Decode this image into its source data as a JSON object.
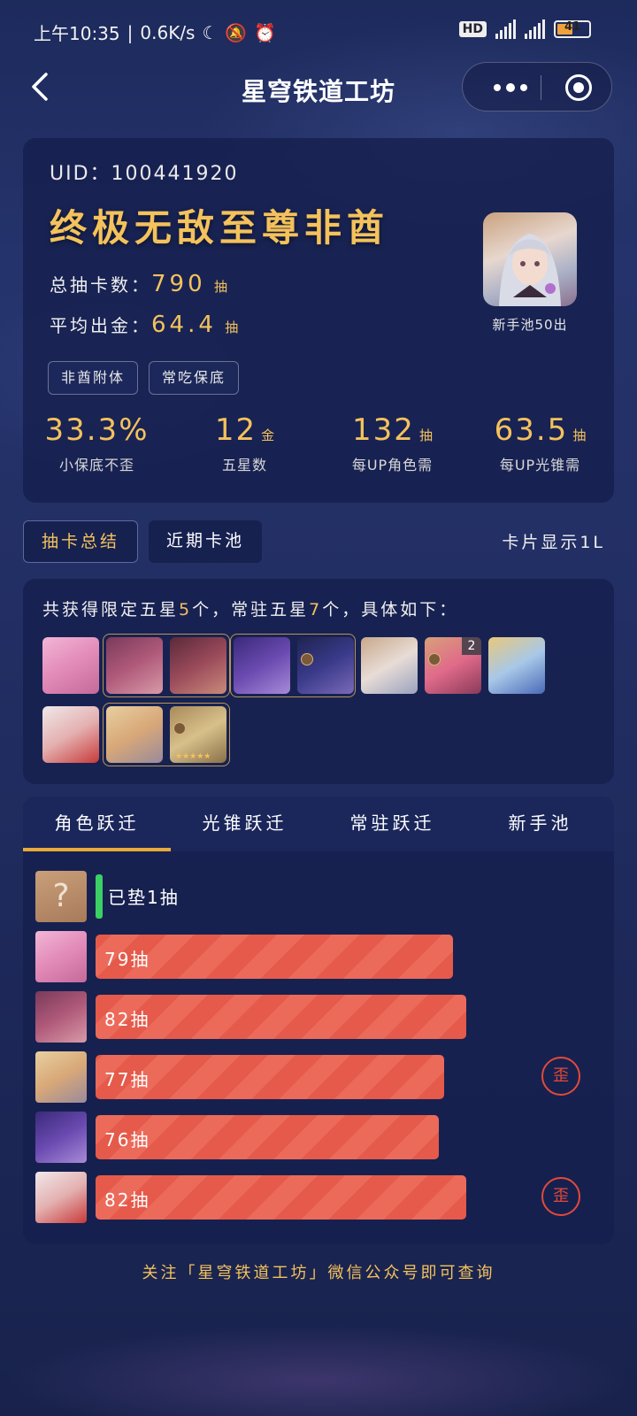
{
  "status_bar": {
    "time": "上午10:35",
    "speed": "0.6K/s",
    "hd": "HD",
    "network_a": "5G",
    "network_b": "5G",
    "battery": "41"
  },
  "header": {
    "title": "星穹铁道工坊"
  },
  "profile": {
    "uid": "UID：100441920",
    "rank_title": "终极无敌至尊非酋",
    "total_label": "总抽卡数：",
    "total_value": "790",
    "total_unit": "抽",
    "avg_label": "平均出金：",
    "avg_value": "64.4",
    "avg_unit": "抽",
    "tags": [
      "非酋附体",
      "常吃保底"
    ],
    "novice_caption": "新手池50出"
  },
  "metrics": [
    {
      "value": "33.3%",
      "unit": "",
      "label": "小保底不歪"
    },
    {
      "value": "12",
      "unit": "金",
      "label": "五星数"
    },
    {
      "value": "132",
      "unit": "抽",
      "label": "每UP角色需"
    },
    {
      "value": "63.5",
      "unit": "抽",
      "label": "每UP光锥需"
    }
  ],
  "view_tabs": {
    "active": "抽卡总结",
    "inactive": "近期卡池",
    "toggle_label": "卡片显示1L"
  },
  "summary": {
    "prefix": "共获得限定五星",
    "limited_count": "5",
    "mid": "个，常驻五星",
    "standard_count": "7",
    "suffix": "个，具体如下：",
    "dupe_count": "2"
  },
  "history_tabs": [
    "角色跃迁",
    "光锥跃迁",
    "常驻跃迁",
    "新手池"
  ],
  "history": {
    "pending": "已垫1抽",
    "question_mark": "?",
    "rows": [
      {
        "label": "79抽",
        "pulls": 79,
        "lost": false
      },
      {
        "label": "82抽",
        "pulls": 82,
        "lost": false
      },
      {
        "label": "77抽",
        "pulls": 77,
        "lost": true
      },
      {
        "label": "76抽",
        "pulls": 76,
        "lost": false
      },
      {
        "label": "82抽",
        "pulls": 82,
        "lost": true
      }
    ],
    "lost_badge": "歪"
  },
  "footer": "关注「星穹铁道工坊」微信公众号即可查询",
  "colors": {
    "gold": "#f4c25c",
    "bar": "#e55a4a",
    "pending": "#3ccf66",
    "lost": "#e24a3a",
    "tab_underline": "#e6a93a"
  }
}
